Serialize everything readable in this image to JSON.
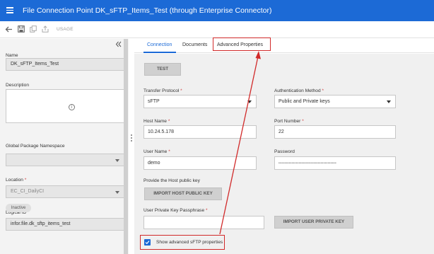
{
  "header": {
    "title": "File Connection Point DK_sFTP_Items_Test (through Enterprise Connector)"
  },
  "toolbar": {
    "usage_label": "USAGE"
  },
  "left_panel": {
    "name_label": "Name",
    "name_value": "DK_sFTP_Items_Test",
    "description_label": "Description",
    "description_value": "",
    "namespace_label": "Global Package Namespace",
    "namespace_value": "",
    "location_label": "Location",
    "location_required": "*",
    "location_value": "EC_CI_DailyCI",
    "logical_id_label": "Logical ID",
    "logical_id_value": "infor.file.dk_sftp_items_test",
    "status_badge": "Inactive"
  },
  "tabs": [
    {
      "label": "Connection"
    },
    {
      "label": "Documents"
    },
    {
      "label": "Advanced Properties"
    }
  ],
  "form": {
    "test_button": "TEST",
    "transfer_protocol_label": "Transfer Protocol",
    "transfer_protocol_value": "sFTP",
    "auth_method_label": "Authentication Method",
    "auth_method_value": "Public and Private keys",
    "host_name_label": "Host Name",
    "host_name_value": "10.24.5.178",
    "port_label": "Port Number",
    "port_value": "22",
    "user_name_label": "User Name",
    "user_name_value": "demo",
    "password_label": "Password",
    "password_value": "••••••••••••••••••••••••••••••••••••••••",
    "host_key_label": "Provide the Host public key",
    "import_host_key_button": "IMPORT HOST PUBLIC KEY",
    "passphrase_label": "User Private Key Passphrase",
    "passphrase_value": "",
    "import_private_key_button": "IMPORT USER PRIVATE KEY",
    "show_advanced_label": "Show advanced sFTP properties",
    "show_advanced_checked": true,
    "required_mark": "*"
  },
  "colors": {
    "header_bg": "#1c6ad6",
    "accent": "#1c6ad6",
    "annotation_red": "#d12a2a"
  }
}
